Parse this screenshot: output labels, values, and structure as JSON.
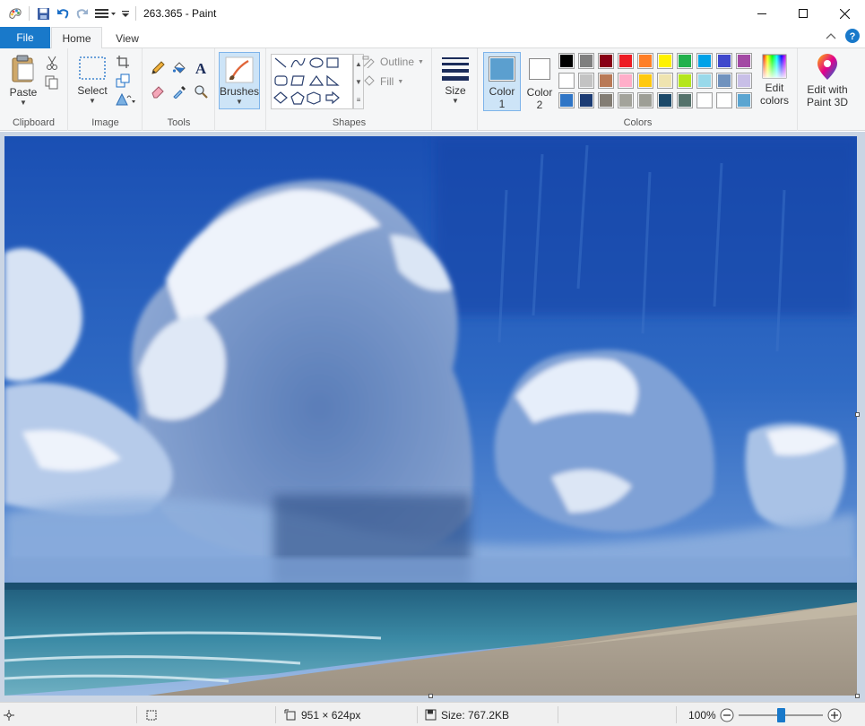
{
  "window": {
    "title": "263.365 - Paint"
  },
  "tabs": {
    "file": "File",
    "home": "Home",
    "view": "View"
  },
  "ribbon": {
    "clipboard": {
      "paste": "Paste",
      "label": "Clipboard"
    },
    "image": {
      "select": "Select",
      "label": "Image"
    },
    "tools": {
      "label": "Tools"
    },
    "brushes": {
      "label": "Brushes"
    },
    "shapes": {
      "outline": "Outline",
      "fill": "Fill",
      "label": "Shapes"
    },
    "size": {
      "label": "Size"
    },
    "colors": {
      "color1": "Color",
      "color1_num": "1",
      "color2": "Color",
      "color2_num": "2",
      "edit_line1": "Edit",
      "edit_line2": "colors",
      "label": "Colors",
      "color1_value": "#5b9fcf",
      "color2_value": "#ffffff",
      "palette": [
        "#000000",
        "#7f7f7f",
        "#880015",
        "#ed1c24",
        "#ff7f27",
        "#fff200",
        "#22b14c",
        "#00a2e8",
        "#3f48cc",
        "#a349a4",
        "#ffffff",
        "#c3c3c3",
        "#b97a57",
        "#ffaec9",
        "#ffc90e",
        "#efe4b0",
        "#b5e61d",
        "#99d9ea",
        "#7092be",
        "#c8bfe7",
        "#2f75c6",
        "#1c3c74",
        "#837d74",
        "#a3a39b",
        "#9d9e96",
        "#1c4969",
        "#55726b",
        "#ffffff",
        "#ffffff",
        "#5ba5d1"
      ]
    },
    "paint3d": {
      "line1": "Edit with",
      "line2": "Paint 3D"
    }
  },
  "statusbar": {
    "dimensions": "951 × 624px",
    "size": "Size: 767.2KB",
    "zoom": "100%",
    "zoom_level": 0.5
  }
}
